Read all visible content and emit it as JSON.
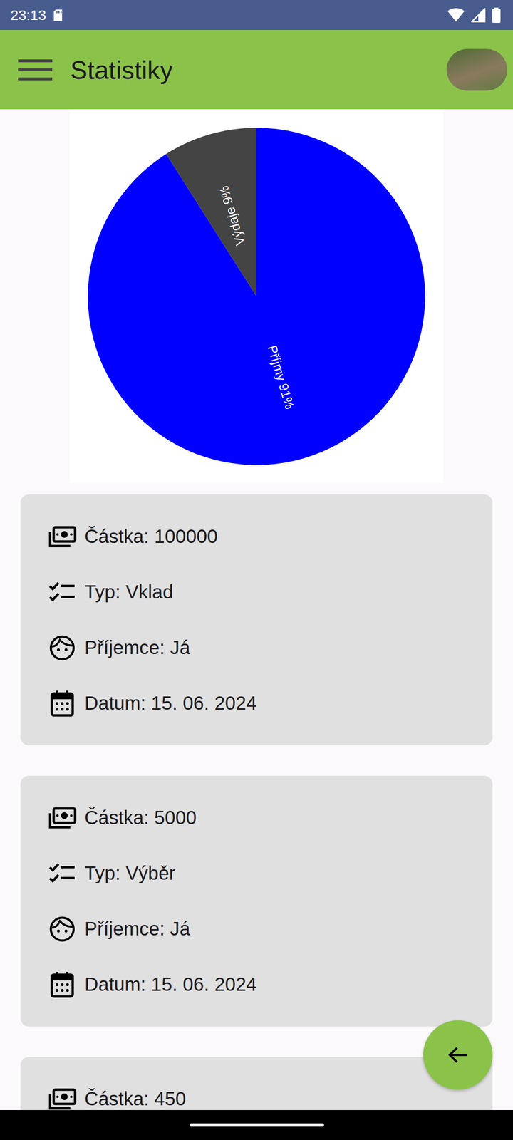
{
  "status_bar": {
    "time": "23:13"
  },
  "app_bar": {
    "title": "Statistiky"
  },
  "chart": {
    "slices": [
      {
        "label": "Příjmy 91%",
        "value": 91,
        "color": "#0000ff"
      },
      {
        "label": "Výdaje 9%",
        "value": 9,
        "color": "#444444"
      }
    ]
  },
  "transactions": [
    {
      "fields": [
        {
          "kind": "amount",
          "text": "Částka: 100000"
        },
        {
          "kind": "type",
          "text": "Typ: Vklad"
        },
        {
          "kind": "recipient",
          "text": "Příjemce: Já"
        },
        {
          "kind": "date",
          "text": "Datum: 15. 06. 2024"
        }
      ]
    },
    {
      "fields": [
        {
          "kind": "amount",
          "text": "Částka: 5000"
        },
        {
          "kind": "type",
          "text": "Typ: Výběr"
        },
        {
          "kind": "recipient",
          "text": "Příjemce: Já"
        },
        {
          "kind": "date",
          "text": "Datum: 15. 06. 2024"
        }
      ]
    },
    {
      "fields": [
        {
          "kind": "amount",
          "text": "Částka: 450"
        }
      ]
    }
  ]
}
